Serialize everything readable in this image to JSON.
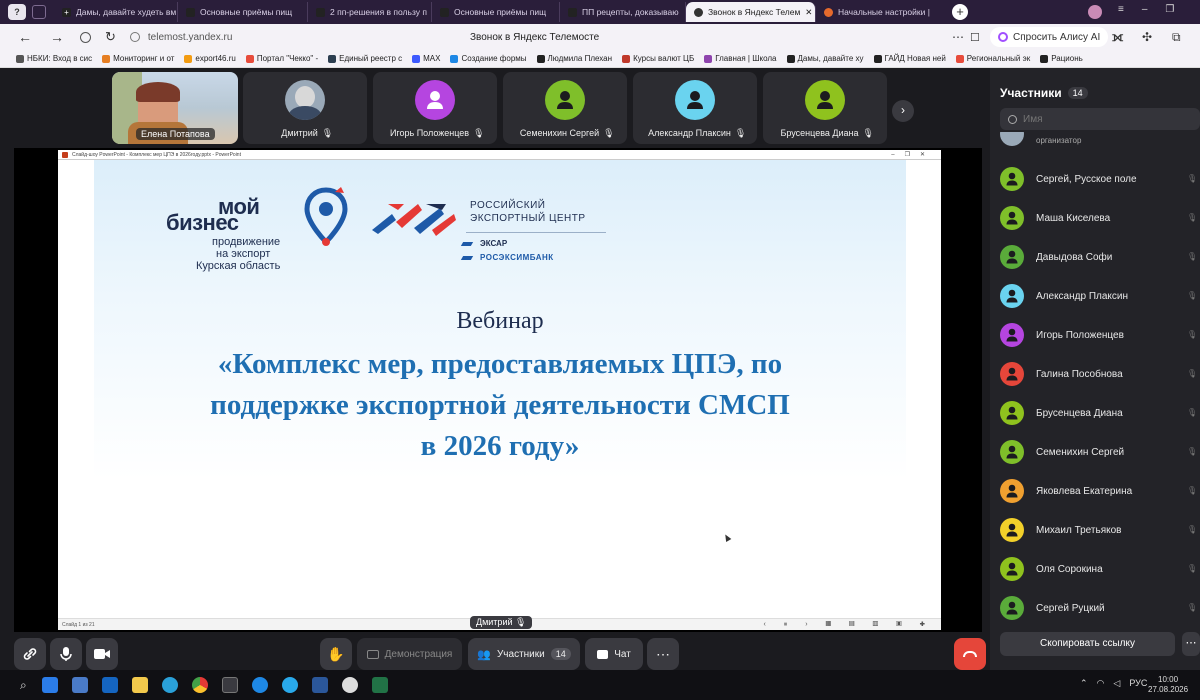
{
  "browser": {
    "tabs": [
      {
        "title": "Дамы, давайте худеть вм",
        "color": "#e8e8e8"
      },
      {
        "title": "Основные приёмы пищ",
        "color": "#e8e8e8"
      },
      {
        "title": "2 пп-решения в пользу п",
        "color": "#e8e8e8"
      },
      {
        "title": "Основные приёмы пищ",
        "color": "#e8e8e8"
      },
      {
        "title": "ПП рецепты, доказываю",
        "color": "#e8e8e8"
      },
      {
        "title": "Звонок в Яндекс Телем",
        "color": "#222222"
      },
      {
        "title": "Начальные настройки |",
        "color": "#e66a2c"
      }
    ],
    "url": "telemost.yandex.ru",
    "page_title": "Звонок в Яндекс Телемосте",
    "ask_alice": "Спросить Алису AI",
    "bookmarks": [
      {
        "label": "НБКИ: Вход в сис",
        "color": "#555555"
      },
      {
        "label": "Мониторинг и от",
        "color": "#e67e22"
      },
      {
        "label": "export46.ru",
        "color": "#f39c12"
      },
      {
        "label": "Портал \"Чекко\" -",
        "color": "#e74c3c"
      },
      {
        "label": "Единый реестр с",
        "color": "#2c3e50"
      },
      {
        "label": "MAX",
        "color": "#3d5afe"
      },
      {
        "label": "Создание формы",
        "color": "#1e88e5"
      },
      {
        "label": "Людмила Плехан",
        "color": "#222222"
      },
      {
        "label": "Курсы валют ЦБ",
        "color": "#c0392b"
      },
      {
        "label": "Главная | Школа",
        "color": "#8e44ad"
      },
      {
        "label": "Дамы, давайте ху",
        "color": "#222222"
      },
      {
        "label": "ГАЙД Новая ней",
        "color": "#222222"
      },
      {
        "label": "Региональный эк",
        "color": "#e74c3c"
      },
      {
        "label": "Рационь",
        "color": "#222222"
      }
    ]
  },
  "call": {
    "self_name": "Елена Потапова",
    "tiles": [
      {
        "name": "Дмитрий",
        "color": "#7a7a80"
      },
      {
        "name": "Игорь Положенцев",
        "color": "#b545e0"
      },
      {
        "name": "Семенихин Сергей",
        "color": "#7fbf2a"
      },
      {
        "name": "Александр Плаксин",
        "color": "#6ad3ef"
      },
      {
        "name": "Брусенцева Диана",
        "color": "#8fc21e"
      }
    ],
    "presenter_label": "Дмитрий",
    "slide": {
      "window_title": "Слайд-шоу PowerPoint  -  Комплекс мер ЦПЭ в 2026году.pptx  -  PowerPoint",
      "status_left": "Слайд 1 из 21",
      "logo1_line1": "мой",
      "logo1_line2": "бизнес",
      "logo1_sub1": "продвижение",
      "logo1_sub2": "на экспорт",
      "logo1_sub3": "Курская область",
      "logo2_line1": "РОССИЙСКИЙ",
      "logo2_line2": "ЭКСПОРТНЫЙ ЦЕНТР",
      "logo2_sub1": "ЭКСАР",
      "logo2_sub2": "РОСЭКСИМБАНК",
      "heading": "Вебинар",
      "title_line1": "«Комплекс мер, предоставляемых ЦПЭ, по",
      "title_line2": "поддержке экспортной деятельности СМСП",
      "title_line3": "в 2026 году»"
    },
    "controls": {
      "demo": "Демонстрация",
      "participants": "Участники",
      "participants_count": "14",
      "chat": "Чат"
    }
  },
  "sidebar": {
    "title": "Участники",
    "count": "14",
    "search_placeholder": "Имя",
    "organizer_label": "организатор",
    "participants": [
      {
        "name": "Сергей, Русское поле",
        "color": "#7fbf2a"
      },
      {
        "name": "Маша Киселева",
        "color": "#7fbf2a"
      },
      {
        "name": "Давыдова Софи",
        "color": "#5aab3a"
      },
      {
        "name": "Александр Плаксин",
        "color": "#6ad3ef"
      },
      {
        "name": "Игорь Положенцев",
        "color": "#b545e0"
      },
      {
        "name": "Галина Пособнова",
        "color": "#e5463a"
      },
      {
        "name": "Брусенцева Диана",
        "color": "#8fc21e"
      },
      {
        "name": "Семенихин Сергей",
        "color": "#7fbf2a"
      },
      {
        "name": "Яковлева Екатерина",
        "color": "#f0a030"
      },
      {
        "name": "Михаил Третьяков",
        "color": "#f2d02a"
      },
      {
        "name": "Оля Сорокина",
        "color": "#8fc21e"
      },
      {
        "name": "Сергей Руцкий",
        "color": "#5aab3a"
      }
    ],
    "copy_link": "Скопировать ссылку"
  },
  "taskbar": {
    "lang": "РУС",
    "time": "10:00",
    "date": "27.08.2026"
  }
}
